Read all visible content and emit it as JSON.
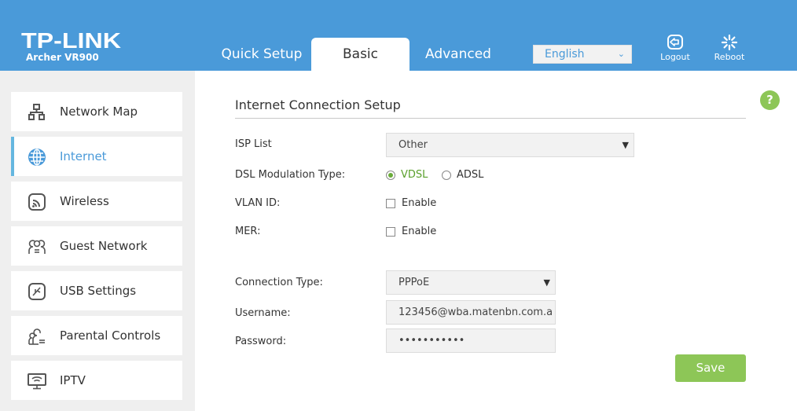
{
  "header": {
    "brand": "TP-LINK",
    "model": "Archer VR900",
    "tabs": [
      {
        "label": "Quick Setup",
        "active": false
      },
      {
        "label": "Basic",
        "active": true
      },
      {
        "label": "Advanced",
        "active": false
      }
    ],
    "language": "English",
    "logout_label": "Logout",
    "reboot_label": "Reboot"
  },
  "sidebar": {
    "items": [
      {
        "label": "Network Map",
        "icon": "network-map-icon"
      },
      {
        "label": "Internet",
        "icon": "globe-icon",
        "active": true
      },
      {
        "label": "Wireless",
        "icon": "wireless-icon"
      },
      {
        "label": "Guest Network",
        "icon": "guest-network-icon"
      },
      {
        "label": "USB Settings",
        "icon": "usb-icon"
      },
      {
        "label": "Parental Controls",
        "icon": "parental-controls-icon"
      },
      {
        "label": "IPTV",
        "icon": "iptv-icon"
      }
    ]
  },
  "colors": {
    "header_bg": "#4a9ad9",
    "accent_green": "#8dc657",
    "active_nav": "#65b7e0"
  },
  "main": {
    "title": "Internet Connection Setup",
    "help_label": "?",
    "isp_list": {
      "label": "ISP List",
      "value": "Other"
    },
    "dsl": {
      "label": "DSL Modulation Type:",
      "options": [
        {
          "label": "VDSL",
          "selected": true
        },
        {
          "label": "ADSL",
          "selected": false
        }
      ]
    },
    "vlan": {
      "label": "VLAN ID:",
      "option": "Enable",
      "checked": false
    },
    "mer": {
      "label": "MER:",
      "option": "Enable",
      "checked": false
    },
    "connection_type": {
      "label": "Connection Type:",
      "value": "PPPoE"
    },
    "username": {
      "label": "Username:",
      "value": "123456@wba.matenbn.com.a"
    },
    "password": {
      "label": "Password:",
      "value": "•••••••••••"
    },
    "save_label": "Save"
  }
}
